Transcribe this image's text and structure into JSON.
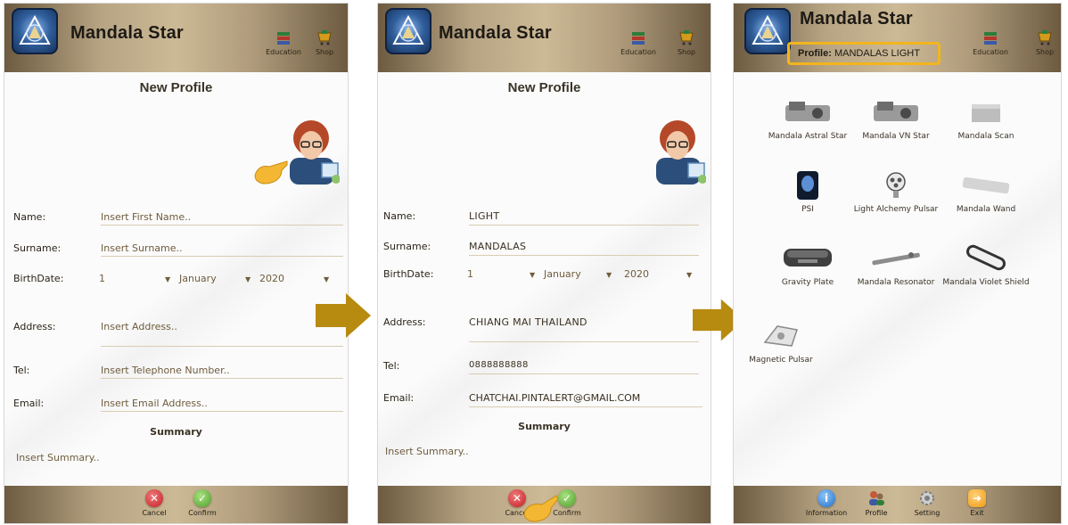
{
  "app": {
    "title": "Mandala Star",
    "toolbar": {
      "education_label": "Education",
      "shop_label": "Shop"
    }
  },
  "screen1": {
    "page_title": "New Profile",
    "fields": {
      "name_label": "Name:",
      "name_placeholder": "Insert First Name..",
      "surname_label": "Surname:",
      "surname_placeholder": "Insert Surname..",
      "birthdate_label": "BirthDate:",
      "day": "1",
      "month": "January",
      "year": "2020",
      "address_label": "Address:",
      "address_placeholder": "Insert Address..",
      "tel_label": "Tel:",
      "tel_placeholder": "Insert Telephone Number..",
      "email_label": "Email:",
      "email_placeholder": "Insert Email Address.."
    },
    "summary_label": "Summary",
    "summary_placeholder": "Insert Summary..",
    "buttons": {
      "cancel": "Cancel",
      "confirm": "Confirm"
    }
  },
  "screen2": {
    "page_title": "New Profile",
    "fields": {
      "name_label": "Name:",
      "name_value": "LIGHT",
      "surname_label": "Surname:",
      "surname_value": "MANDALAS",
      "birthdate_label": "BirthDate:",
      "day": "1",
      "month": "January",
      "year": "2020",
      "address_label": "Address:",
      "address_value": "CHIANG MAI THAILAND",
      "tel_label": "Tel:",
      "tel_value": "0888888888",
      "email_label": "Email:",
      "email_value": "CHATCHAI.PINTALERT@GMAIL.COM"
    },
    "summary_label": "Summary",
    "summary_placeholder": "Insert Summary..",
    "buttons": {
      "cancel": "Cancel",
      "confirm": "Confirm"
    }
  },
  "screen3": {
    "profile_label": "Profile:",
    "profile_value": "MANDALAS LIGHT",
    "devices": [
      "Mandala Astral Star",
      "Mandala VN Star",
      "Mandala Scan",
      "PSI",
      "Light Alchemy Pulsar",
      "Mandala Wand",
      "Gravity Plate",
      "Mandala Resonator",
      "Mandala Violet Shield",
      "Magnetic Pulsar"
    ],
    "bottom_nav": {
      "information": "Information",
      "profile": "Profile",
      "setting": "Setting",
      "exit": "Exit"
    }
  },
  "colors": {
    "bar_gold": "#ccb995",
    "highlight": "#f2b51d",
    "arrow": "#b78a10"
  },
  "icons": [
    "app-logo-icon",
    "education-icon",
    "shop-icon",
    "avatar-icon",
    "cancel-icon",
    "confirm-icon",
    "information-icon",
    "profile-icon",
    "setting-icon",
    "exit-icon",
    "next-arrow-icon",
    "pointing-hand-icon"
  ]
}
